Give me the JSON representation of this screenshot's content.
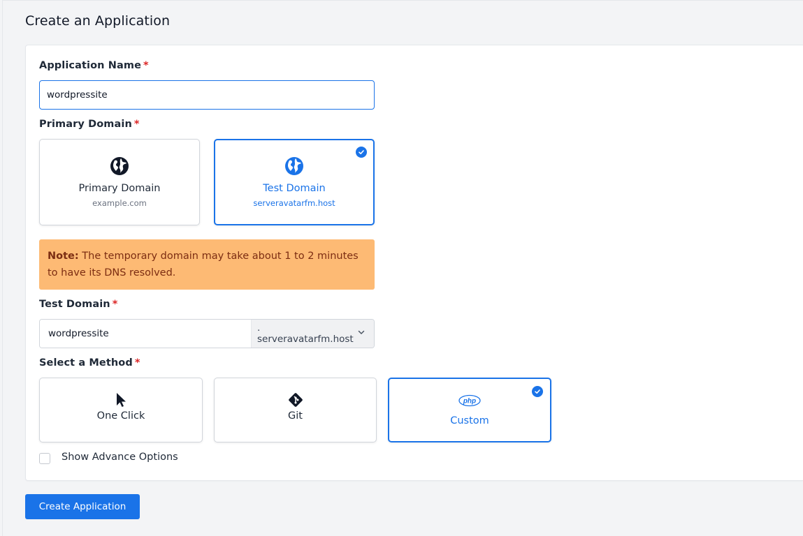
{
  "page": {
    "title": "Create an Application"
  },
  "form": {
    "app_name": {
      "label": "Application Name",
      "required": "*",
      "value": "wordpressite"
    },
    "primary_domain": {
      "label": "Primary Domain",
      "required": "*",
      "options": [
        {
          "title": "Primary Domain",
          "sub": "example.com",
          "icon": "globe-icon",
          "selected": false
        },
        {
          "title": "Test Domain",
          "sub": "serveravatarfm.host",
          "icon": "globe-icon",
          "selected": true
        }
      ]
    },
    "note": {
      "prefix": "Note:",
      "text": " The temporary domain may take about 1 to 2 minutes to have its DNS resolved."
    },
    "test_domain": {
      "label": "Test Domain",
      "required": "*",
      "value": "wordpressite",
      "suffix": ". serveravatarfm.host"
    },
    "method": {
      "label": "Select a Method",
      "required": "*",
      "options": [
        {
          "title": "One Click",
          "icon": "cursor-icon",
          "selected": false
        },
        {
          "title": "Git",
          "icon": "git-icon",
          "selected": false
        },
        {
          "title": "Custom",
          "icon": "php-icon",
          "selected": true
        }
      ]
    },
    "advanced": {
      "label": "Show Advance Options",
      "checked": false
    },
    "submit_label": "Create Application"
  },
  "colors": {
    "accent": "#1a73e8",
    "required": "#dc2626",
    "note_bg": "#fdba74",
    "note_text": "#7c2d12"
  }
}
